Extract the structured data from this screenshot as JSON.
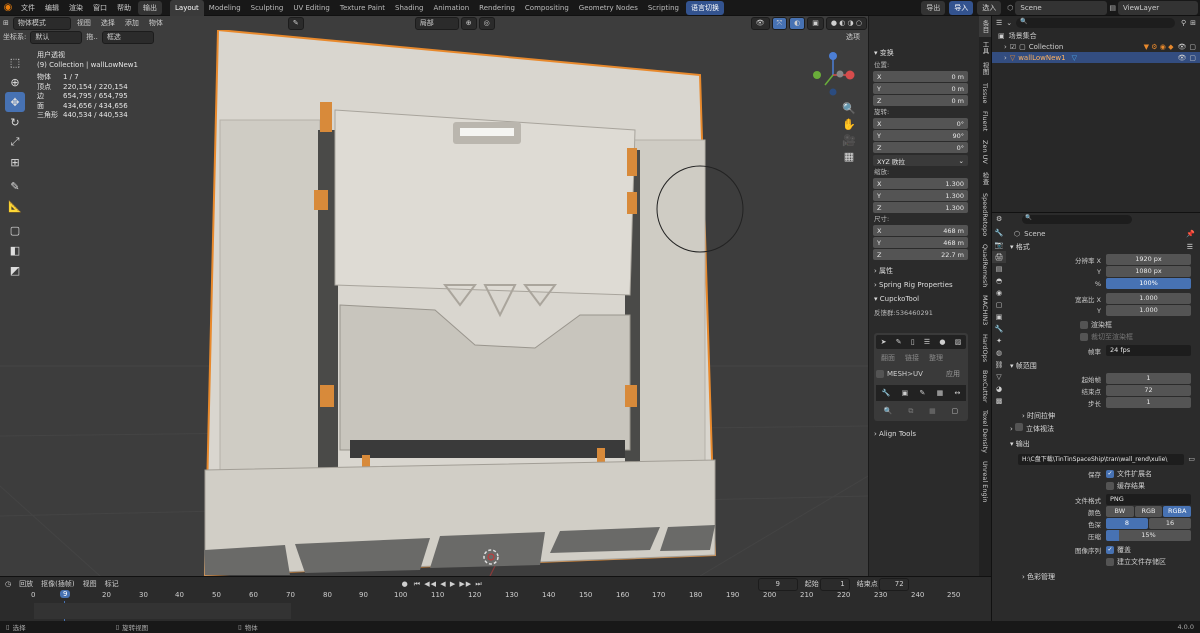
{
  "topbar": {
    "menus": [
      "文件",
      "编辑",
      "渲染",
      "窗口",
      "帮助"
    ],
    "render_pill": "输出",
    "workspaces": [
      "Layout",
      "Modeling",
      "Sculpting",
      "UV Editing",
      "Texture Paint",
      "Shading",
      "Animation",
      "Rendering",
      "Compositing",
      "Geometry Nodes",
      "Scripting"
    ],
    "lang_btn": "语言切换",
    "right_btns": [
      "导出",
      "导入",
      "选入"
    ],
    "scene": "Scene",
    "viewlayer": "ViewLayer"
  },
  "viewport": {
    "mode": "物体模式",
    "menus": [
      "视图",
      "选择",
      "添加",
      "物体"
    ],
    "coord_label": "坐标系:",
    "coord_val": "默认",
    "drag_label": "拖..",
    "drag_val": "框选",
    "pivot": "局部",
    "options": "选项",
    "stats": {
      "title": "用户透视",
      "collection": "(9) Collection | wallLowNew1",
      "rows": [
        [
          "物体",
          "1 / 7"
        ],
        [
          "顶点",
          "220,154 / 220,154"
        ],
        [
          "边",
          "654,795 / 654,795"
        ],
        [
          "面",
          "434,656 / 434,656"
        ],
        [
          "三角形",
          "440,534 / 440,534"
        ]
      ]
    }
  },
  "npanel": {
    "transform": "变换",
    "location": "位置:",
    "rotation": "旋转:",
    "scale": "缩放:",
    "dimensions": "尺寸:",
    "loc": [
      [
        "X",
        "0 m"
      ],
      [
        "Y",
        "0 m"
      ],
      [
        "Z",
        "0 m"
      ]
    ],
    "rot": [
      [
        "X",
        "0°"
      ],
      [
        "Y",
        "90°"
      ],
      [
        "Z",
        "0°"
      ]
    ],
    "rot_mode": "XYZ 欧拉",
    "scl": [
      [
        "X",
        "1.300"
      ],
      [
        "Y",
        "1.300"
      ],
      [
        "Z",
        "1.300"
      ]
    ],
    "dim": [
      [
        "X",
        "468 m"
      ],
      [
        "Y",
        "468 m"
      ],
      [
        "Z",
        "22.7 m"
      ]
    ],
    "props": "属性",
    "spring": "Spring Rig Properties",
    "cupcko": "CupckoTool",
    "feedback": "反馈群:536460291",
    "mesh_uv": "MESH>UV",
    "apply": "应用",
    "align": "Align Tools",
    "chk_labels": [
      "翻面",
      "链接",
      "整理"
    ]
  },
  "sidetabs": [
    "条目",
    "工具",
    "视图",
    "Tissue",
    "Fluent",
    "Zen UV",
    "检查",
    "SpeedRetopo",
    "QuadRemesh",
    "MACHIN3",
    "HardOps",
    "BoxCutter",
    "Texel Density",
    "Unreal Engin"
  ],
  "outliner": {
    "root": "场景集合",
    "items": [
      {
        "name": "Collection"
      },
      {
        "name": "wallLowNew1"
      }
    ]
  },
  "properties": {
    "scene": "Scene",
    "format": "格式",
    "res_x_lbl": "分辨率 X",
    "res_x": "1920 px",
    "res_y_lbl": "Y",
    "res_y": "1080 px",
    "pct_lbl": "%",
    "pct": "100%",
    "aspect_x_lbl": "宽高比 X",
    "aspect_x": "1.000",
    "aspect_y_lbl": "Y",
    "aspect_y": "1.000",
    "border": "渲染框",
    "crop": "裁切至渲染框",
    "fps_lbl": "帧率",
    "fps": "24 fps",
    "frame_range": "帧范围",
    "start_lbl": "起始帧",
    "start": "1",
    "end_lbl": "结束点",
    "end": "72",
    "step_lbl": "步长",
    "step": "1",
    "time_stretch": "时间拉伸",
    "stereo": "立体视法",
    "output": "输出",
    "path": "H:\\C盘下载\\TinTinSpaceShip\\tran\\wall_rend\\xulie\\",
    "save_lbl": "保存",
    "file_ext": "文件扩展名",
    "cache": "缓存结果",
    "file_format_lbl": "文件格式",
    "file_format": "PNG",
    "color_lbl": "颜色",
    "color_opts": [
      "BW",
      "RGB",
      "RGBA"
    ],
    "depth_lbl": "色深",
    "depth_opts": [
      "8",
      "16"
    ],
    "compress_lbl": "压缩",
    "compress": "15%",
    "seq_lbl": "图像序列",
    "overwrite": "覆盖",
    "placeholder": "建立文件存储区",
    "color_mgmt": "色彩管理"
  },
  "timeline": {
    "menus": [
      "回放",
      "抠像(插帧)",
      "视图",
      "标记"
    ],
    "current": "9",
    "start_lbl": "起始",
    "start": "1",
    "end_lbl": "结束点",
    "end": "72",
    "ticks": [
      "0",
      "10",
      "20",
      "30",
      "40",
      "50",
      "60",
      "70",
      "80",
      "90",
      "100",
      "110",
      "120",
      "130",
      "140",
      "150",
      "160",
      "170",
      "180",
      "190",
      "200",
      "210",
      "220",
      "230",
      "240",
      "250"
    ],
    "playhead": "9"
  },
  "status": {
    "items": [
      "选择",
      "旋转视图",
      "物体"
    ],
    "version": "4.0.0"
  },
  "colors": {
    "accent": "#4772b3",
    "orange": "#e8892c"
  }
}
